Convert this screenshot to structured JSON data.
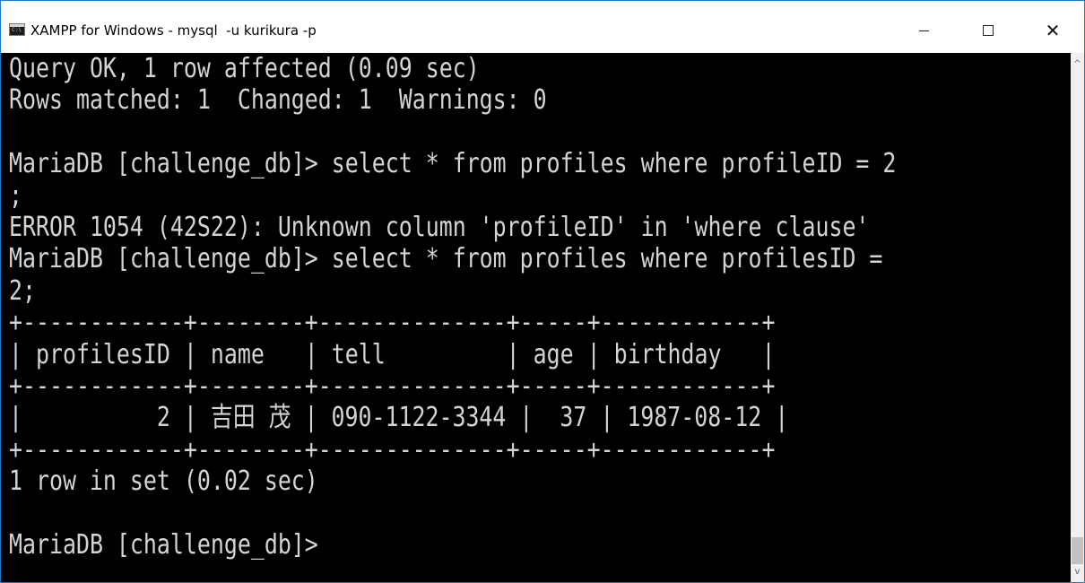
{
  "window": {
    "title": "XAMPP for Windows - mysql  -u kurikura -p",
    "icon_label": "C:\\",
    "icon": "console-icon",
    "buttons": {
      "minimize_icon": "minimize-icon",
      "maximize_icon": "maximize-icon",
      "close_icon": "close-icon",
      "close_glyph": "✕"
    }
  },
  "console": {
    "lines": [
      "Query OK, 1 row affected (0.09 sec)",
      "Rows matched: 1  Changed: 1  Warnings: 0",
      "",
      "MariaDB [challenge_db]> select * from profiles where profileID = 2",
      ";",
      "ERROR 1054 (42S22): Unknown column 'profileID' in 'where clause'",
      "MariaDB [challenge_db]> select * from profiles where profilesID =",
      "2;",
      "+------------+--------+--------------+-----+------------+",
      "| profilesID | name   | tell         | age | birthday   |",
      "+------------+--------+--------------+-----+------------+",
      "|          2 | 吉田 茂 | 090-1122-3344 |  37 | 1987-08-12 |",
      "+------------+--------+--------------+-----+------------+",
      "1 row in set (0.02 sec)",
      "",
      "MariaDB [challenge_db]>"
    ],
    "colors": {
      "background": "#000000",
      "text": "#d4d4d4"
    }
  },
  "scrollbar": {
    "up_glyph": "^",
    "down_glyph": "v"
  }
}
